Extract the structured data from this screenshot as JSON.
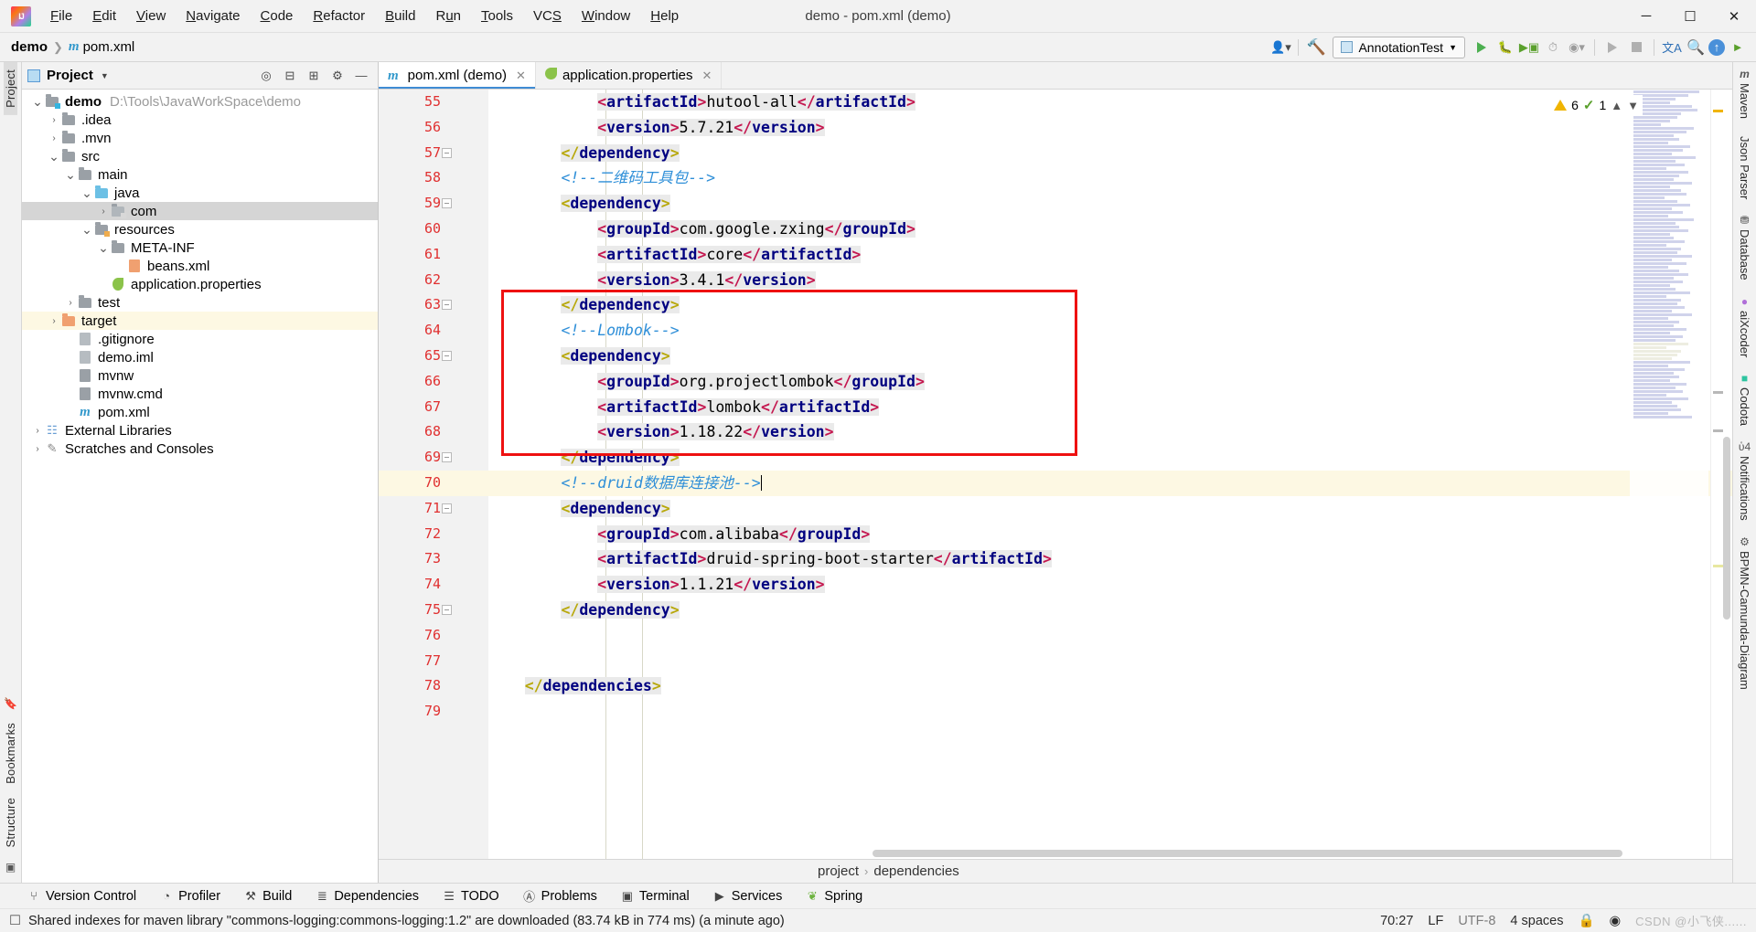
{
  "window": {
    "title": "demo - pom.xml (demo)",
    "logo_icon": "intellij-idea-logo",
    "minimize_icon": "minimize-icon",
    "maximize_icon": "maximize-icon",
    "close_icon": "close-icon"
  },
  "menubar": [
    {
      "label": "File",
      "acc": "F"
    },
    {
      "label": "Edit",
      "acc": "E"
    },
    {
      "label": "View",
      "acc": "V"
    },
    {
      "label": "Navigate",
      "acc": "N"
    },
    {
      "label": "Code",
      "acc": "C"
    },
    {
      "label": "Refactor",
      "acc": "R"
    },
    {
      "label": "Build",
      "acc": "B"
    },
    {
      "label": "Run",
      "acc": "u"
    },
    {
      "label": "Tools",
      "acc": "T"
    },
    {
      "label": "VCS",
      "acc": "S"
    },
    {
      "label": "Window",
      "acc": "W"
    },
    {
      "label": "Help",
      "acc": "H"
    }
  ],
  "navbar": {
    "project": "demo",
    "file": "pom.xml",
    "file_icon": "maven-m-icon",
    "run_config": "AnnotationTest",
    "run_config_icon": "application-icon",
    "icons": [
      "person-dropdown-icon",
      "hammer-build-icon",
      "run-icon",
      "debug-icon",
      "run-with-coverage-icon",
      "profiler-icon",
      "attach-dropdown-icon",
      "rerun-icon",
      "stop-icon",
      "translate-icon",
      "search-icon",
      "updates-icon",
      "ide-helper-icon"
    ]
  },
  "left_rail": {
    "top_label": "Project",
    "bottom_labels": [
      "Bookmarks",
      "Structure"
    ]
  },
  "project_panel": {
    "title": "Project",
    "title_icon": "project-view-icon",
    "dropdown_icon": "chevron-down-icon",
    "actions": [
      "locate-icon",
      "expand-all-icon",
      "collapse-all-icon",
      "settings-gear-icon",
      "hide-icon"
    ],
    "tree": [
      {
        "depth": 0,
        "twisty": "expanded",
        "icon": "module-folder-icon",
        "label": "demo",
        "bold": true,
        "path": "D:\\Tools\\JavaWorkSpace\\demo",
        "state": "normal"
      },
      {
        "depth": 1,
        "twisty": "collapsed",
        "icon": "folder-icon",
        "label": ".idea",
        "state": "normal"
      },
      {
        "depth": 1,
        "twisty": "collapsed",
        "icon": "folder-icon",
        "label": ".mvn",
        "state": "normal"
      },
      {
        "depth": 1,
        "twisty": "expanded",
        "icon": "folder-icon",
        "label": "src",
        "state": "normal"
      },
      {
        "depth": 2,
        "twisty": "expanded",
        "icon": "folder-icon",
        "label": "main",
        "state": "normal"
      },
      {
        "depth": 3,
        "twisty": "expanded",
        "icon": "sources-folder-icon",
        "label": "java",
        "state": "normal"
      },
      {
        "depth": 4,
        "twisty": "collapsed",
        "icon": "package-icon",
        "label": "com",
        "state": "selected"
      },
      {
        "depth": 3,
        "twisty": "expanded",
        "icon": "resources-folder-icon",
        "label": "resources",
        "state": "normal"
      },
      {
        "depth": 4,
        "twisty": "expanded",
        "icon": "folder-icon",
        "label": "META-INF",
        "state": "normal"
      },
      {
        "depth": 5,
        "twisty": "none",
        "icon": "xml-file-icon",
        "label": "beans.xml",
        "state": "normal"
      },
      {
        "depth": 4,
        "twisty": "none",
        "icon": "spring-properties-icon",
        "label": "application.properties",
        "state": "normal"
      },
      {
        "depth": 2,
        "twisty": "collapsed",
        "icon": "folder-icon",
        "label": "test",
        "state": "normal"
      },
      {
        "depth": 1,
        "twisty": "collapsed",
        "icon": "excluded-folder-icon",
        "label": "target",
        "state": "highlighted"
      },
      {
        "depth": 2,
        "twisty": "none",
        "icon": "gitignore-file-icon",
        "label": ".gitignore",
        "state": "normal"
      },
      {
        "depth": 2,
        "twisty": "none",
        "icon": "iml-file-icon",
        "label": "demo.iml",
        "state": "normal"
      },
      {
        "depth": 2,
        "twisty": "none",
        "icon": "shell-script-icon",
        "label": "mvnw",
        "state": "normal"
      },
      {
        "depth": 2,
        "twisty": "none",
        "icon": "cmd-script-icon",
        "label": "mvnw.cmd",
        "state": "normal"
      },
      {
        "depth": 2,
        "twisty": "none",
        "icon": "maven-m-icon",
        "label": "pom.xml",
        "state": "normal"
      },
      {
        "depth": 0,
        "twisty": "collapsed",
        "icon": "external-libraries-icon",
        "label": "External Libraries",
        "state": "normal"
      },
      {
        "depth": 0,
        "twisty": "collapsed",
        "icon": "scratches-icon",
        "label": "Scratches and Consoles",
        "state": "normal"
      }
    ]
  },
  "editor": {
    "tabs": [
      {
        "label": "pom.xml (demo)",
        "icon": "maven-m-icon",
        "active": true,
        "close_icon": "close-icon"
      },
      {
        "label": "application.properties",
        "icon": "spring-properties-icon",
        "active": false,
        "close_icon": "close-icon"
      }
    ],
    "first_line": 55,
    "current_line": 70,
    "inspections": {
      "warning_count": "6",
      "warning_icon": "warning-triangle-icon",
      "ok_count": "1",
      "ok_icon": "checkmark-icon",
      "up_icon": "chevron-up-icon",
      "down_icon": "chevron-down-icon"
    },
    "lines": [
      {
        "n": 55,
        "indent": 3,
        "fold": "none",
        "tokens": [
          {
            "t": "ang",
            "v": "<"
          },
          {
            "t": "tag",
            "v": "artifactId"
          },
          {
            "t": "ang",
            "v": ">"
          },
          {
            "t": "txt",
            "v": "hutool-all"
          },
          {
            "t": "ang",
            "v": "</"
          },
          {
            "t": "tag",
            "v": "artifactId"
          },
          {
            "t": "ang",
            "v": ">"
          }
        ]
      },
      {
        "n": 56,
        "indent": 3,
        "fold": "none",
        "tokens": [
          {
            "t": "ang",
            "v": "<"
          },
          {
            "t": "tag",
            "v": "version"
          },
          {
            "t": "ang",
            "v": ">"
          },
          {
            "t": "txt",
            "v": "5.7.21"
          },
          {
            "t": "ang",
            "v": "</"
          },
          {
            "t": "tag",
            "v": "version"
          },
          {
            "t": "ang",
            "v": ">"
          }
        ]
      },
      {
        "n": 57,
        "indent": 2,
        "fold": "end",
        "tokens": [
          {
            "t": "angy",
            "v": "</"
          },
          {
            "t": "tag",
            "v": "dependency"
          },
          {
            "t": "angy",
            "v": ">"
          }
        ]
      },
      {
        "n": 58,
        "indent": 2,
        "fold": "none",
        "tokens": [
          {
            "t": "cmt",
            "v": "<!--二维码工具包-->"
          }
        ]
      },
      {
        "n": 59,
        "indent": 2,
        "fold": "start",
        "tokens": [
          {
            "t": "angy",
            "v": "<"
          },
          {
            "t": "tag",
            "v": "dependency"
          },
          {
            "t": "angy",
            "v": ">"
          }
        ]
      },
      {
        "n": 60,
        "indent": 3,
        "fold": "none",
        "tokens": [
          {
            "t": "ang",
            "v": "<"
          },
          {
            "t": "tag",
            "v": "groupId"
          },
          {
            "t": "ang",
            "v": ">"
          },
          {
            "t": "txt",
            "v": "com.google.zxing"
          },
          {
            "t": "ang",
            "v": "</"
          },
          {
            "t": "tag",
            "v": "groupId"
          },
          {
            "t": "ang",
            "v": ">"
          }
        ]
      },
      {
        "n": 61,
        "indent": 3,
        "fold": "none",
        "tokens": [
          {
            "t": "ang",
            "v": "<"
          },
          {
            "t": "tag",
            "v": "artifactId"
          },
          {
            "t": "ang",
            "v": ">"
          },
          {
            "t": "txt",
            "v": "core"
          },
          {
            "t": "ang",
            "v": "</"
          },
          {
            "t": "tag",
            "v": "artifactId"
          },
          {
            "t": "ang",
            "v": ">"
          }
        ]
      },
      {
        "n": 62,
        "indent": 3,
        "fold": "none",
        "tokens": [
          {
            "t": "ang",
            "v": "<"
          },
          {
            "t": "tag",
            "v": "version"
          },
          {
            "t": "ang",
            "v": ">"
          },
          {
            "t": "txt",
            "v": "3.4.1"
          },
          {
            "t": "ang",
            "v": "</"
          },
          {
            "t": "tag",
            "v": "version"
          },
          {
            "t": "ang",
            "v": ">"
          }
        ]
      },
      {
        "n": 63,
        "indent": 2,
        "fold": "end",
        "tokens": [
          {
            "t": "angy",
            "v": "</"
          },
          {
            "t": "tag",
            "v": "dependency"
          },
          {
            "t": "angy",
            "v": ">"
          }
        ]
      },
      {
        "n": 64,
        "indent": 2,
        "fold": "none",
        "tokens": [
          {
            "t": "cmt",
            "v": "<!--Lombok-->"
          }
        ]
      },
      {
        "n": 65,
        "indent": 2,
        "fold": "start",
        "tokens": [
          {
            "t": "angy",
            "v": "<"
          },
          {
            "t": "tag",
            "v": "dependency"
          },
          {
            "t": "angy",
            "v": ">"
          }
        ]
      },
      {
        "n": 66,
        "indent": 3,
        "fold": "none",
        "tokens": [
          {
            "t": "ang",
            "v": "<"
          },
          {
            "t": "tag",
            "v": "groupId"
          },
          {
            "t": "ang",
            "v": ">"
          },
          {
            "t": "txt",
            "v": "org.projectlombok"
          },
          {
            "t": "ang",
            "v": "</"
          },
          {
            "t": "tag",
            "v": "groupId"
          },
          {
            "t": "ang",
            "v": ">"
          }
        ]
      },
      {
        "n": 67,
        "indent": 3,
        "fold": "none",
        "tokens": [
          {
            "t": "ang",
            "v": "<"
          },
          {
            "t": "tag",
            "v": "artifactId"
          },
          {
            "t": "ang",
            "v": ">"
          },
          {
            "t": "txt",
            "v": "lombok"
          },
          {
            "t": "ang",
            "v": "</"
          },
          {
            "t": "tag",
            "v": "artifactId"
          },
          {
            "t": "ang",
            "v": ">"
          }
        ]
      },
      {
        "n": 68,
        "indent": 3,
        "fold": "none",
        "tokens": [
          {
            "t": "ang",
            "v": "<"
          },
          {
            "t": "tag",
            "v": "version"
          },
          {
            "t": "ang",
            "v": ">"
          },
          {
            "t": "txt",
            "v": "1.18.22"
          },
          {
            "t": "ang",
            "v": "</"
          },
          {
            "t": "tag",
            "v": "version"
          },
          {
            "t": "ang",
            "v": ">"
          }
        ]
      },
      {
        "n": 69,
        "indent": 2,
        "fold": "end",
        "tokens": [
          {
            "t": "angy",
            "v": "</"
          },
          {
            "t": "tag",
            "v": "dependency"
          },
          {
            "t": "angy",
            "v": ">"
          }
        ]
      },
      {
        "n": 70,
        "indent": 2,
        "fold": "none",
        "current": true,
        "tokens": [
          {
            "t": "cmt",
            "v": "<!--druid数据库连接池-->"
          },
          {
            "t": "caret",
            "v": ""
          }
        ]
      },
      {
        "n": 71,
        "indent": 2,
        "fold": "start",
        "tokens": [
          {
            "t": "angy",
            "v": "<"
          },
          {
            "t": "tag",
            "v": "dependency"
          },
          {
            "t": "angy",
            "v": ">"
          }
        ]
      },
      {
        "n": 72,
        "indent": 3,
        "fold": "none",
        "tokens": [
          {
            "t": "ang",
            "v": "<"
          },
          {
            "t": "tag",
            "v": "groupId"
          },
          {
            "t": "ang",
            "v": ">"
          },
          {
            "t": "txt",
            "v": "com.alibaba"
          },
          {
            "t": "ang",
            "v": "</"
          },
          {
            "t": "tag",
            "v": "groupId"
          },
          {
            "t": "ang",
            "v": ">"
          }
        ]
      },
      {
        "n": 73,
        "indent": 3,
        "fold": "none",
        "tokens": [
          {
            "t": "ang",
            "v": "<"
          },
          {
            "t": "tag",
            "v": "artifactId"
          },
          {
            "t": "ang",
            "v": ">"
          },
          {
            "t": "txt",
            "v": "druid-spring-boot-starter"
          },
          {
            "t": "ang",
            "v": "</"
          },
          {
            "t": "tag",
            "v": "artifactId"
          },
          {
            "t": "ang",
            "v": ">"
          }
        ]
      },
      {
        "n": 74,
        "indent": 3,
        "fold": "none",
        "tokens": [
          {
            "t": "ang",
            "v": "<"
          },
          {
            "t": "tag",
            "v": "version"
          },
          {
            "t": "ang",
            "v": ">"
          },
          {
            "t": "txt",
            "v": "1.1.21"
          },
          {
            "t": "ang",
            "v": "</"
          },
          {
            "t": "tag",
            "v": "version"
          },
          {
            "t": "ang",
            "v": ">"
          }
        ]
      },
      {
        "n": 75,
        "indent": 2,
        "fold": "end",
        "tokens": [
          {
            "t": "angy",
            "v": "</"
          },
          {
            "t": "tag",
            "v": "dependency"
          },
          {
            "t": "angy",
            "v": ">"
          }
        ]
      },
      {
        "n": 76,
        "indent": 0,
        "fold": "none",
        "tokens": []
      },
      {
        "n": 77,
        "indent": 0,
        "fold": "none",
        "tokens": []
      },
      {
        "n": 78,
        "indent": 1,
        "fold": "none",
        "tokens": [
          {
            "t": "angy",
            "v": "</"
          },
          {
            "t": "tag",
            "v": "dependencies"
          },
          {
            "t": "angy",
            "v": ">"
          }
        ]
      },
      {
        "n": 79,
        "indent": 0,
        "fold": "none",
        "tokens": []
      }
    ],
    "breadcrumb": [
      {
        "label": "project"
      },
      {
        "label": "dependencies"
      }
    ],
    "breadcrumb_sep": "›"
  },
  "right_rail": [
    {
      "label": "Maven",
      "icon": "maven-m-icon"
    },
    {
      "label": "Json Parser",
      "icon": "json-parser-icon"
    },
    {
      "label": "Database",
      "icon": "database-icon"
    },
    {
      "label": "aiXcoder",
      "icon": "aixcoder-icon"
    },
    {
      "label": "Codota",
      "icon": "codota-icon"
    },
    {
      "label": "Notifications",
      "icon": "notifications-bell-icon"
    },
    {
      "label": "BPMN-Camunda-Diagram",
      "icon": "bpmn-diagram-icon"
    }
  ],
  "tool_windows": [
    {
      "label": "Version Control",
      "icon": "branch-icon"
    },
    {
      "label": "Profiler",
      "icon": "profiler-icon"
    },
    {
      "label": "Build",
      "icon": "hammer-icon"
    },
    {
      "label": "Dependencies",
      "icon": "dependencies-icon"
    },
    {
      "label": "TODO",
      "icon": "todo-list-icon"
    },
    {
      "label": "Problems",
      "icon": "problems-icon"
    },
    {
      "label": "Terminal",
      "icon": "terminal-icon"
    },
    {
      "label": "Services",
      "icon": "services-icon"
    },
    {
      "label": "Spring",
      "icon": "spring-leaf-icon"
    }
  ],
  "statusbar": {
    "message_icon": "event-log-icon",
    "message": "Shared indexes for maven library \"commons-logging:commons-logging:1.2\" are downloaded (83.74 kB in 774 ms) (a minute ago)",
    "caret_position": "70:27",
    "line_separator": "LF",
    "encoding": "UTF-8",
    "indent": "4 spaces",
    "lock_icon": "read-only-lock-icon",
    "inspection_icon": "inspection-level-icon",
    "watermark": "CSDN @小飞侠......"
  }
}
